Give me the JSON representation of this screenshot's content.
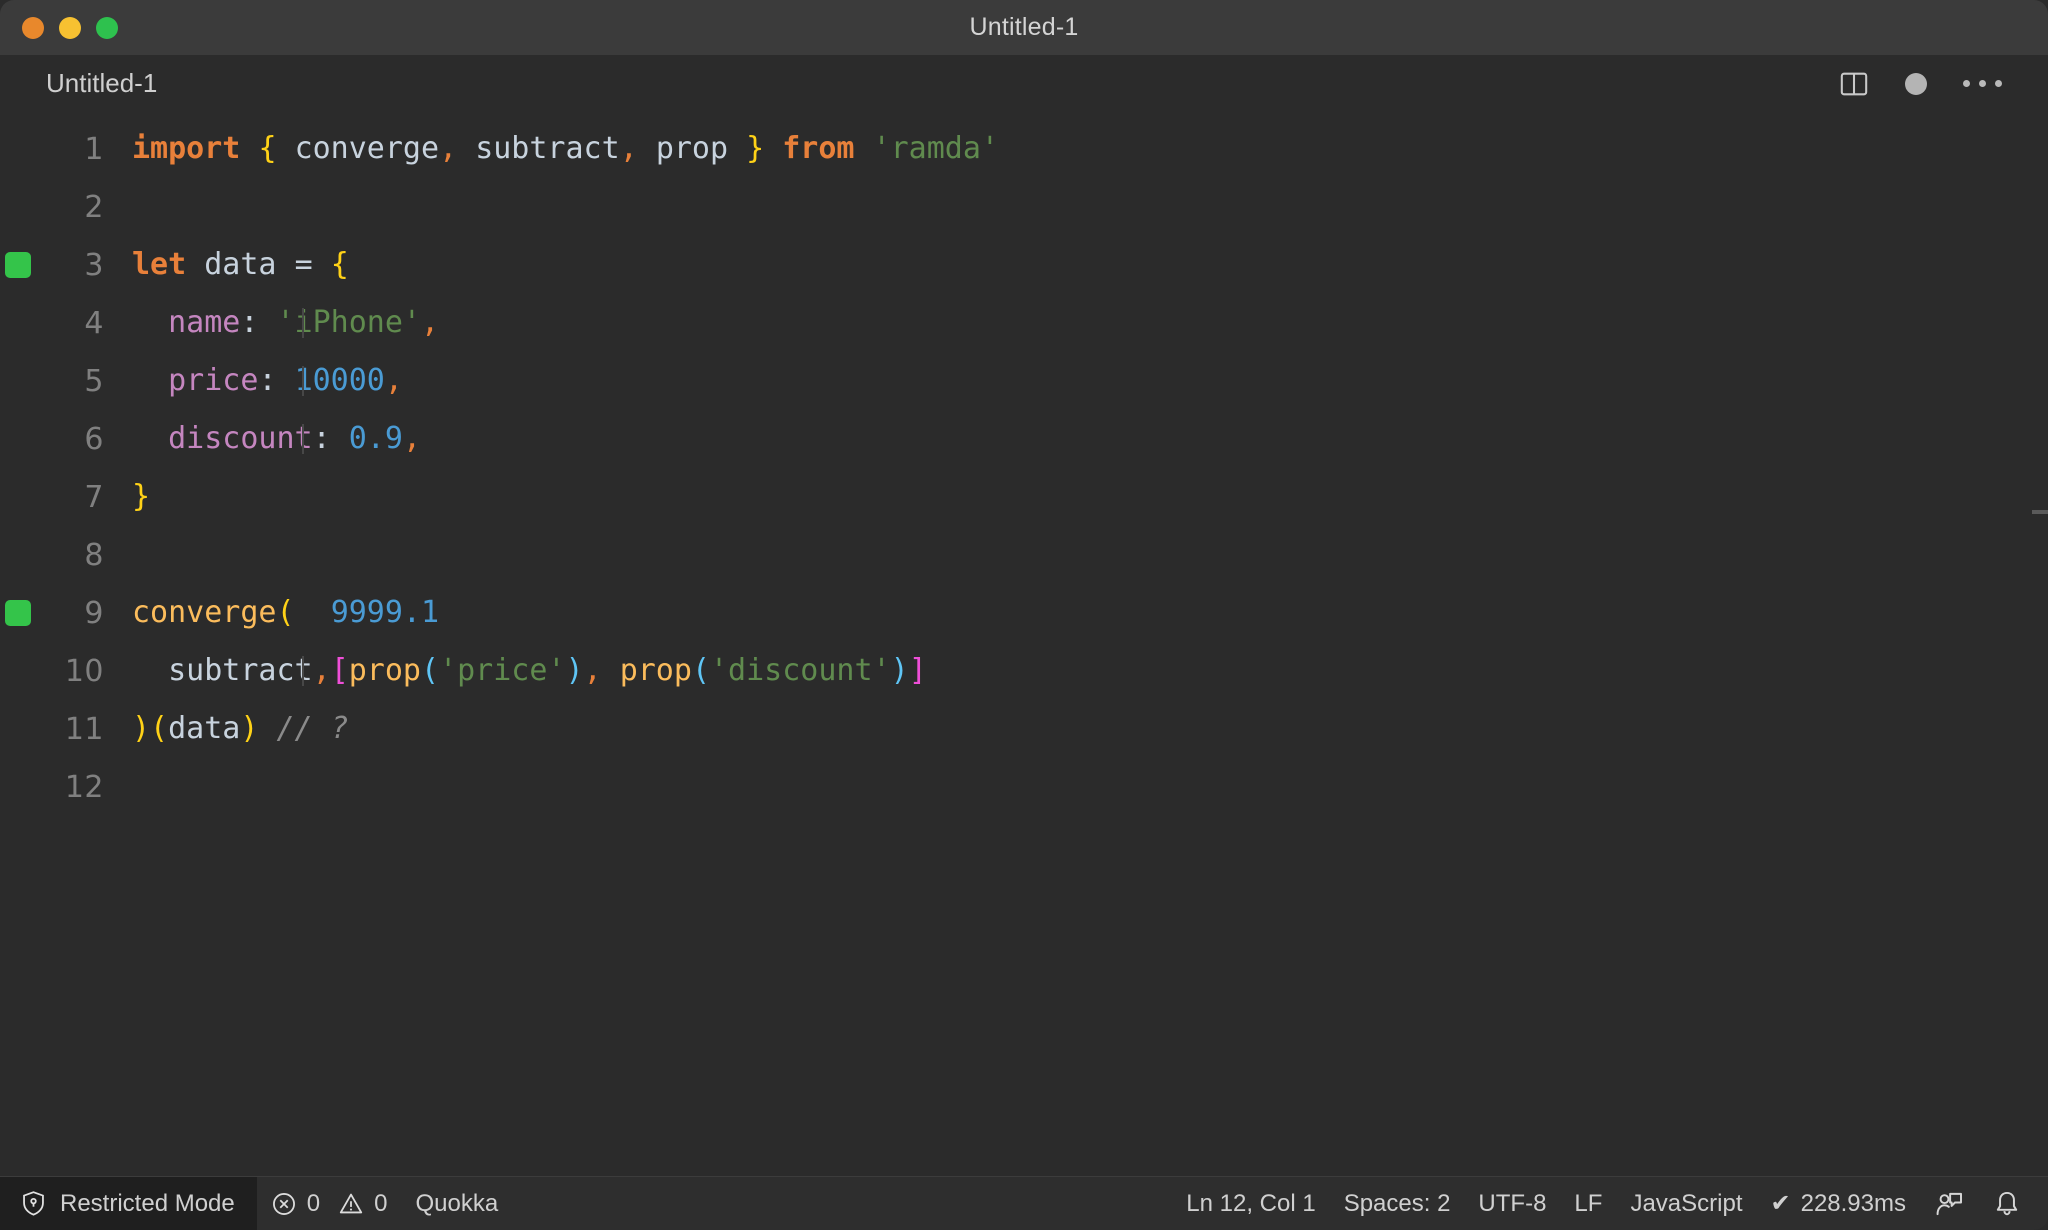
{
  "window": {
    "title": "Untitled-1",
    "controls": [
      {
        "name": "close",
        "color": "#e8882c"
      },
      {
        "name": "minimize",
        "color": "#f7c131"
      },
      {
        "name": "maximize",
        "color": "#2ec14e"
      }
    ]
  },
  "tab": {
    "label": "Untitled-1",
    "actions": [
      {
        "icon": "split-editor-icon",
        "label": "Split Editor Right"
      },
      {
        "icon": "unsaved-dot-icon",
        "label": "Unsaved changes"
      },
      {
        "icon": "more-actions-icon",
        "label": "More Actions..."
      }
    ]
  },
  "editor": {
    "language": "JavaScript",
    "lines": [
      {
        "n": "1",
        "quokka": false,
        "indent": false,
        "current": false
      },
      {
        "n": "2",
        "quokka": false,
        "indent": false,
        "current": false
      },
      {
        "n": "3",
        "quokka": true,
        "indent": false,
        "current": false
      },
      {
        "n": "4",
        "quokka": false,
        "indent": true,
        "current": false
      },
      {
        "n": "5",
        "quokka": false,
        "indent": true,
        "current": false
      },
      {
        "n": "6",
        "quokka": false,
        "indent": true,
        "current": false
      },
      {
        "n": "7",
        "quokka": false,
        "indent": false,
        "current": false
      },
      {
        "n": "8",
        "quokka": false,
        "indent": false,
        "current": false
      },
      {
        "n": "9",
        "quokka": true,
        "indent": false,
        "current": false
      },
      {
        "n": "10",
        "quokka": false,
        "indent": true,
        "current": false
      },
      {
        "n": "11",
        "quokka": false,
        "indent": false,
        "current": false
      },
      {
        "n": "12",
        "quokka": false,
        "indent": false,
        "current": true
      }
    ],
    "source": [
      "import { converge, subtract, prop } from 'ramda'",
      "",
      "let data = {",
      "  name: 'iPhone',",
      "  price: 10000,",
      "  discount: 0.9,",
      "}",
      "",
      "converge(  9999.1",
      "  subtract,[prop('price'), prop('discount')]",
      ")(data) // ?",
      ""
    ],
    "inline_values": [
      {
        "line": "9",
        "value": "9999.1"
      }
    ]
  },
  "statusbar": {
    "restricted_mode": "Restricted Mode",
    "errors": "0",
    "warnings": "0",
    "quokka": "Quokka",
    "position": "Ln 12, Col 1",
    "indentation": "Spaces: 2",
    "encoding": "UTF-8",
    "eol": "LF",
    "language": "JavaScript",
    "run_time": "228.93ms",
    "run_check": "✔",
    "feedback_icon": "feedback-icon",
    "bell_icon": "bell-icon"
  },
  "colors": {
    "background": "#2b2b2b",
    "titlebar": "#3b3b3b",
    "statusbar": "#2e2e2e",
    "keyword": "#e8803a",
    "string": "#608b4e",
    "number": "#4a9bd4",
    "property": "#c586c0",
    "function": "#fbbc5c",
    "comment": "#8a8a8a",
    "bracket_yellow": "#ffd217",
    "bracket_pink": "#ef4fd8",
    "bracket_blue": "#5fc5f5",
    "quokka_marker": "#34c44a"
  }
}
